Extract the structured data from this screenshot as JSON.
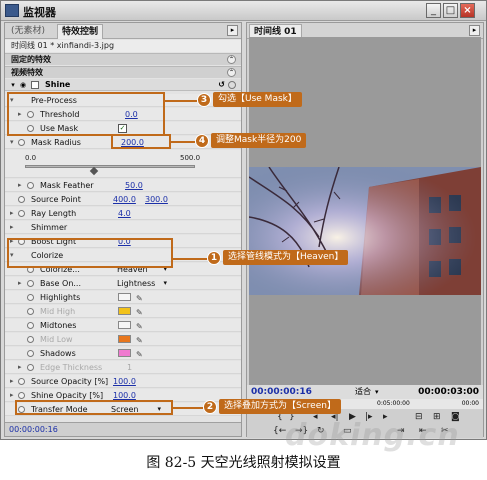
{
  "window": {
    "title": "监视器"
  },
  "left_panel": {
    "tabs": [
      "(无素材)",
      "特效控制"
    ],
    "clip_label": "时间线 01 * xinfiandi-3.jpg",
    "fixed_effects": "固定的特效",
    "video_effects": "视频特效",
    "effect_name": "Shine",
    "rows": {
      "pre_process": "Pre-Process",
      "threshold": {
        "label": "Threshold",
        "value": "0.0"
      },
      "use_mask": {
        "label": "Use Mask",
        "checked": "✓"
      },
      "mask_radius": {
        "label": "Mask Radius",
        "value": "200.0",
        "min": "0.0",
        "max": "500.0"
      },
      "mask_feather": {
        "label": "Mask Feather",
        "value": "50.0"
      },
      "source_point": {
        "label": "Source Point",
        "x": "400.0",
        "y": "300.0"
      },
      "ray_length": {
        "label": "Ray Length",
        "value": "4.0"
      },
      "shimmer": {
        "label": "Shimmer"
      },
      "boost_light": {
        "label": "Boost Light",
        "value": "0.0"
      },
      "colorize_group": {
        "label": "Colorize"
      },
      "colorize": {
        "label": "Colorize...",
        "value": "Heaven"
      },
      "base_on": {
        "label": "Base On...",
        "value": "Lightness"
      },
      "highlights": {
        "label": "Highlights",
        "color": "#f6f6f6"
      },
      "mid_high": {
        "label": "Mid High",
        "color": "#f2c21a"
      },
      "midtones": {
        "label": "Midtones",
        "color": "#f6f6f6"
      },
      "mid_low": {
        "label": "Mid Low",
        "color": "#e8771e"
      },
      "shadows": {
        "label": "Shadows",
        "color": "#f07ad0"
      },
      "edge_thickness": {
        "label": "Edge Thickness",
        "value": "1"
      },
      "source_opacity": {
        "label": "Source Opacity [%]",
        "value": "100.0"
      },
      "shine_opacity": {
        "label": "Shine Opacity [%]",
        "value": "100.0"
      },
      "transfer_mode": {
        "label": "Transfer Mode",
        "value": "Screen"
      }
    },
    "timecode": "00:00:00:16"
  },
  "right_panel": {
    "tab": "时间线 01",
    "timecode_left": "00:00:00:16",
    "fit": "适合",
    "timecode_right": "00:00:03:00",
    "ruler_mid": "0:05:00:00",
    "ruler_right": "00:00"
  },
  "callouts": [
    {
      "num": "3",
      "text": "勾选【Use Mask】"
    },
    {
      "num": "4",
      "text": "调整Mask半径为200"
    },
    {
      "num": "1",
      "text": "选择管线模式为【Heaven】"
    },
    {
      "num": "2",
      "text": "选择叠加方式为【Screen】"
    }
  ],
  "caption": "图 82-5    天空光线照射模拟设置",
  "watermark": "doking.cn"
}
